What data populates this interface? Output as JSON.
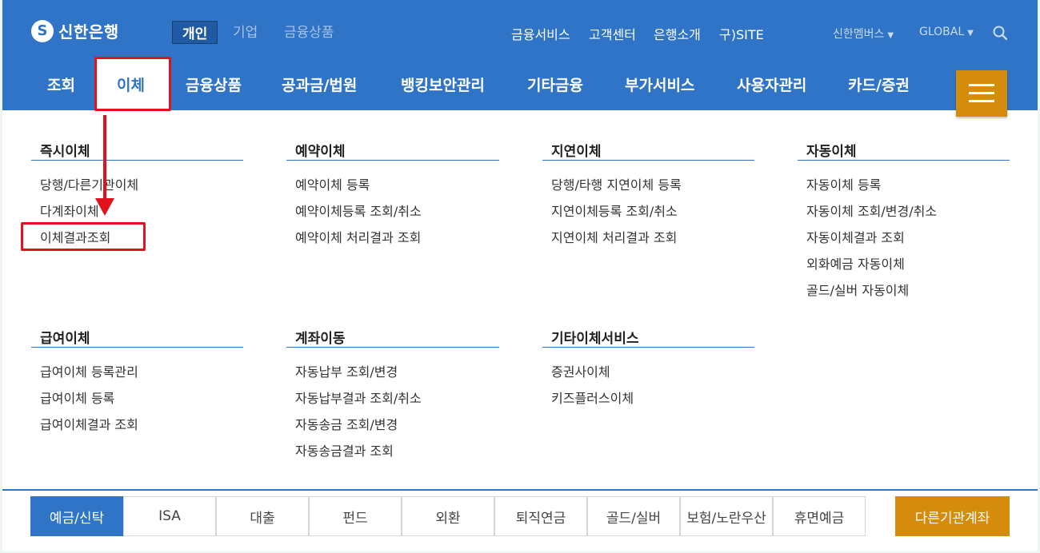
{
  "brand": {
    "logo_mark": "S",
    "name": "신한은행"
  },
  "segments": [
    "개인",
    "기업",
    "금융상품"
  ],
  "util_links": [
    "금융서비스",
    "고객센터",
    "은행소개",
    "구)SITE"
  ],
  "member_menu": {
    "label": "신한멤버스",
    "caret": "▼"
  },
  "global_menu": {
    "label": "GLOBAL",
    "caret": "▼"
  },
  "nav": [
    "조회",
    "이체",
    "금융상품",
    "공과금/법원",
    "뱅킹보안관리",
    "기타금융",
    "부가서비스",
    "사용자관리",
    "카드/증권"
  ],
  "menu": {
    "groups": [
      {
        "title": "즉시이체",
        "items": [
          "당행/다른기관이체",
          "다계좌이체",
          "이체결과조회"
        ]
      },
      {
        "title": "예약이체",
        "items": [
          "예약이체 등록",
          "예약이체등록 조회/취소",
          "예약이체 처리결과 조회"
        ]
      },
      {
        "title": "지연이체",
        "items": [
          "당행/타행 지연이체 등록",
          "지연이체등록 조회/취소",
          "지연이체 처리결과 조회"
        ]
      },
      {
        "title": "자동이체",
        "items": [
          "자동이체 등록",
          "자동이체 조회/변경/취소",
          "자동이체결과 조회",
          "외화예금 자동이체",
          "골드/실버 자동이체"
        ]
      },
      {
        "title": "급여이체",
        "items": [
          "급여이체 등록관리",
          "급여이체 등록",
          "급여이체결과 조회"
        ]
      },
      {
        "title": "계좌이동",
        "items": [
          "자동납부 조회/변경",
          "자동납부결과 조회/취소",
          "자동송금 조회/변경",
          "자동송금결과 조회"
        ]
      },
      {
        "title": "기타이체서비스",
        "items": [
          "증권사이체",
          "키즈플러스이체"
        ]
      }
    ]
  },
  "bottom_tabs": [
    "예금/신탁",
    "ISA",
    "대출",
    "펀드",
    "외환",
    "퇴직연금",
    "골드/실버",
    "보험/노란우산",
    "휴면예금",
    "다른기관계좌"
  ],
  "colors": {
    "primary": "#2f74c6",
    "accent": "#d58b0c",
    "highlight": "#e0121e"
  }
}
